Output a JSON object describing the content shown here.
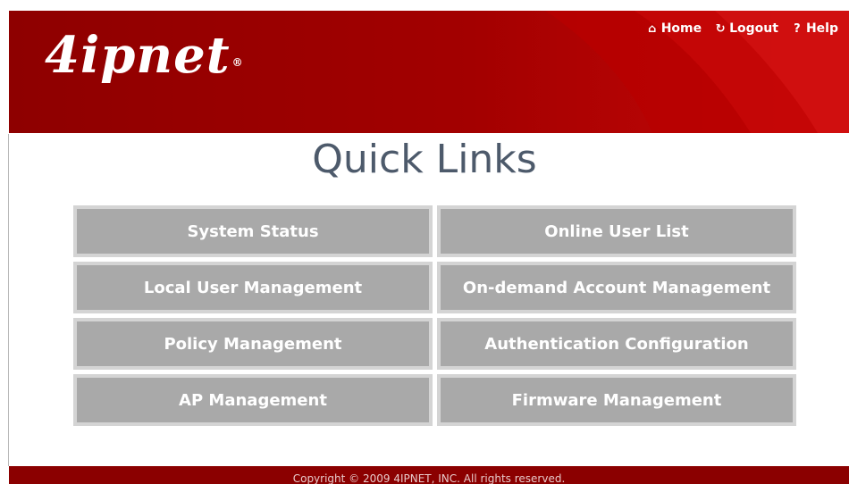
{
  "header": {
    "logo_text": "4ipnet",
    "logo_mark": "®",
    "nav": [
      {
        "label": "Home",
        "icon": "home-icon",
        "glyph": "⌂"
      },
      {
        "label": "Logout",
        "icon": "power-icon",
        "glyph": "↻"
      },
      {
        "label": "Help",
        "icon": "help-icon",
        "glyph": "?"
      }
    ]
  },
  "main": {
    "title": "Quick Links",
    "links": [
      "System Status",
      "Online User List",
      "Local User Management",
      "On-demand Account Management",
      "Policy Management",
      "Authentication Configuration",
      "AP Management",
      "Firmware Management"
    ]
  },
  "footer": {
    "copyright": "Copyright © 2009 4IPNET, INC. All rights reserved."
  },
  "colors": {
    "header_bg": "#9c0000",
    "button_bg": "#a9a9a9",
    "button_border": "#d4d4d4",
    "title_color": "#4d5a6b"
  }
}
